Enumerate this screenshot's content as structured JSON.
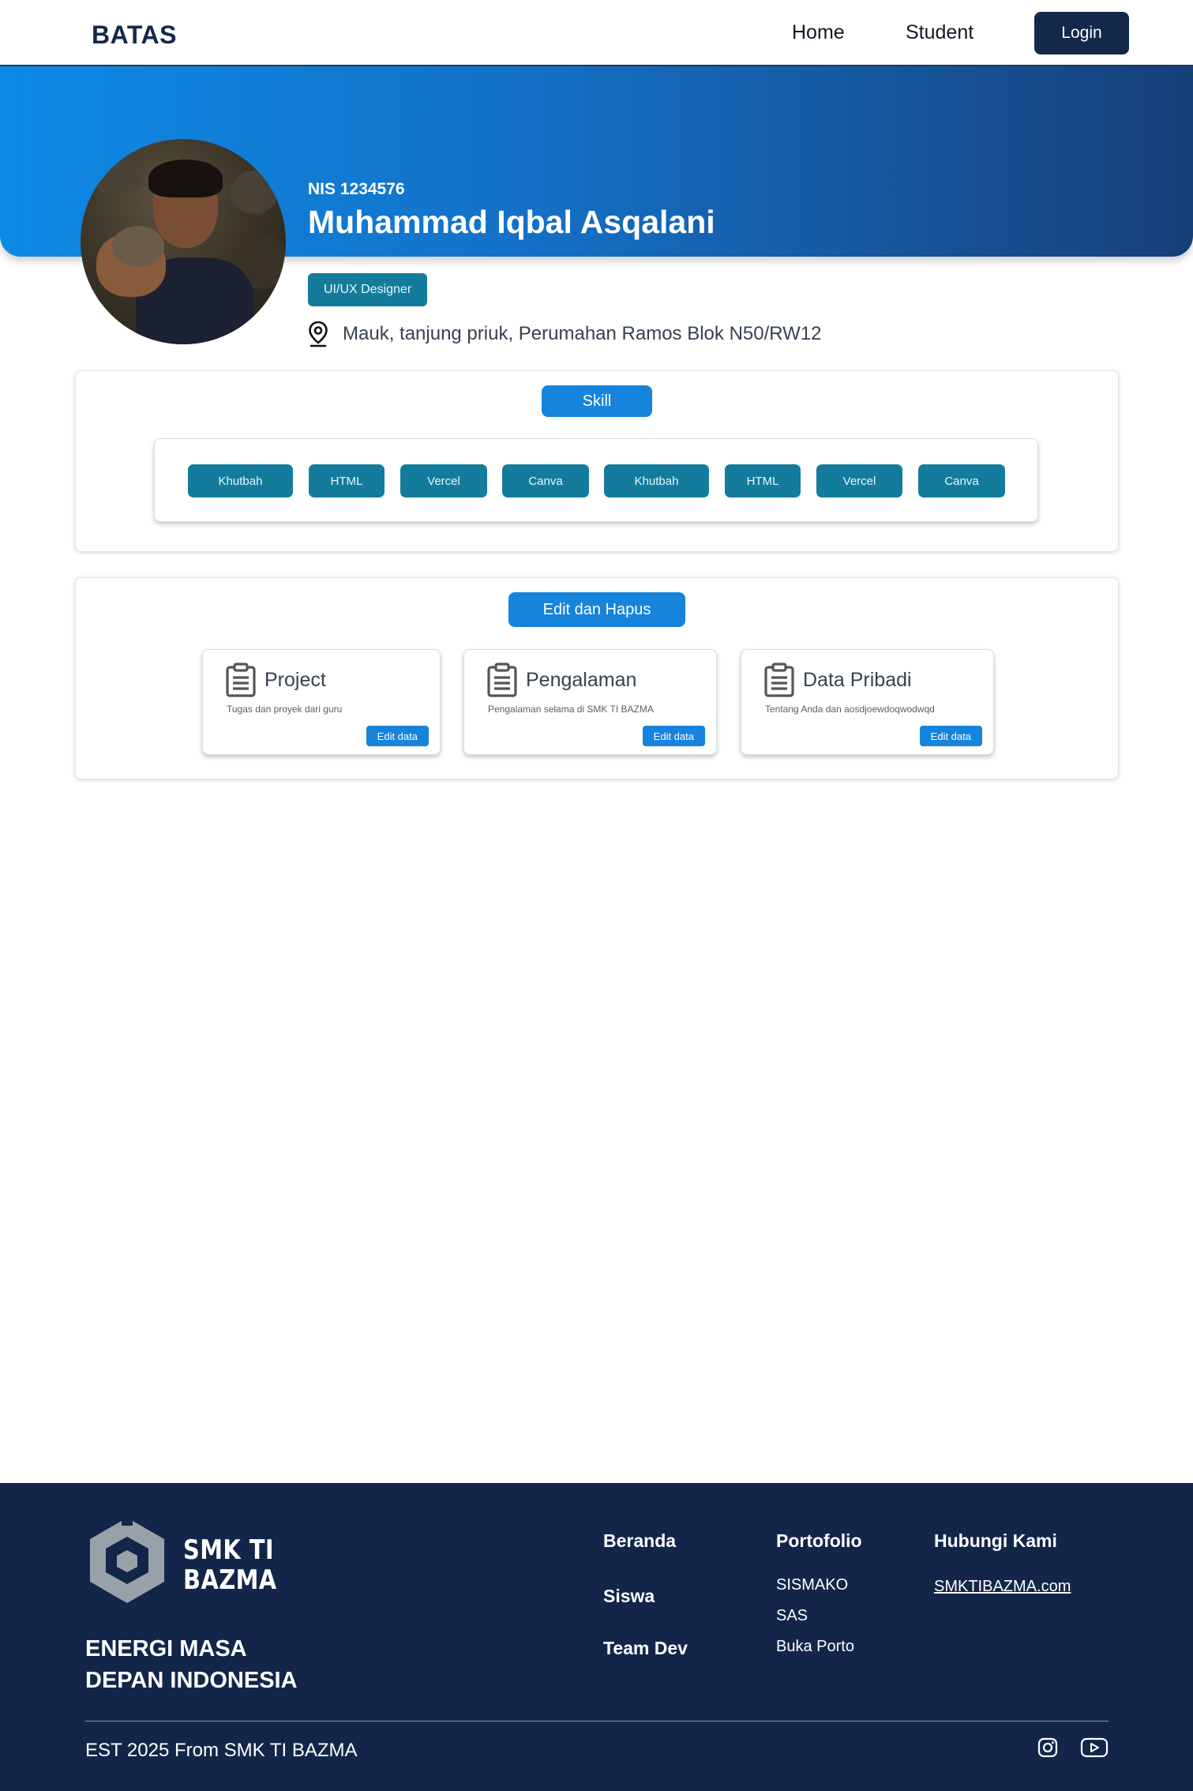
{
  "nav": {
    "brand": "BATAS",
    "home": "Home",
    "student": "Student",
    "login": "Login"
  },
  "profile": {
    "nis": "NIS 1234576",
    "name": "Muhammad Iqbal Asqalani",
    "role": "UI/UX Designer",
    "address": "Mauk, tanjung priuk, Perumahan Ramos Blok N50/RW12"
  },
  "skills": {
    "title": "Skill",
    "items": [
      "Khutbah",
      "HTML",
      "Vercel",
      "Canva",
      "Khutbah",
      "HTML",
      "Vercel",
      "Canva"
    ]
  },
  "edit": {
    "title": "Edit dan Hapus",
    "cards": [
      {
        "title": "Project",
        "desc": "Tugas dan proyek dari guru",
        "button": "Edit data"
      },
      {
        "title": "Pengalaman",
        "desc": "Pengalaman selama di SMK TI BAZMA",
        "button": "Edit data"
      },
      {
        "title": "Data Pribadi",
        "desc": "Tentang Anda dan aosdjoewdoqwodwqd",
        "button": "Edit data"
      }
    ]
  },
  "footer": {
    "logo_line1": "SMK TI",
    "logo_line2": "BAZMA",
    "tagline_line1": "ENERGI MASA",
    "tagline_line2": "DEPAN INDONESIA",
    "links": {
      "beranda": "Beranda",
      "siswa": "Siswa",
      "team_dev": "Team Dev"
    },
    "portfolio": {
      "heading": "Portofolio",
      "items": [
        "SISMAKO",
        "SAS",
        "Buka Porto"
      ]
    },
    "contact": {
      "heading": "Hubungi Kami",
      "link": "SMKTIBAZMA.com"
    },
    "copyright": "EST 2025 From SMK TI BAZMA"
  },
  "colors": {
    "navy": "#13294b",
    "accent_blue": "#1683dc",
    "teal": "#137c9c",
    "footer_bg": "#13264a"
  },
  "icons": {
    "location": "location-pin-icon",
    "clipboard": "clipboard-icon",
    "instagram": "instagram-icon",
    "youtube": "youtube-icon"
  }
}
